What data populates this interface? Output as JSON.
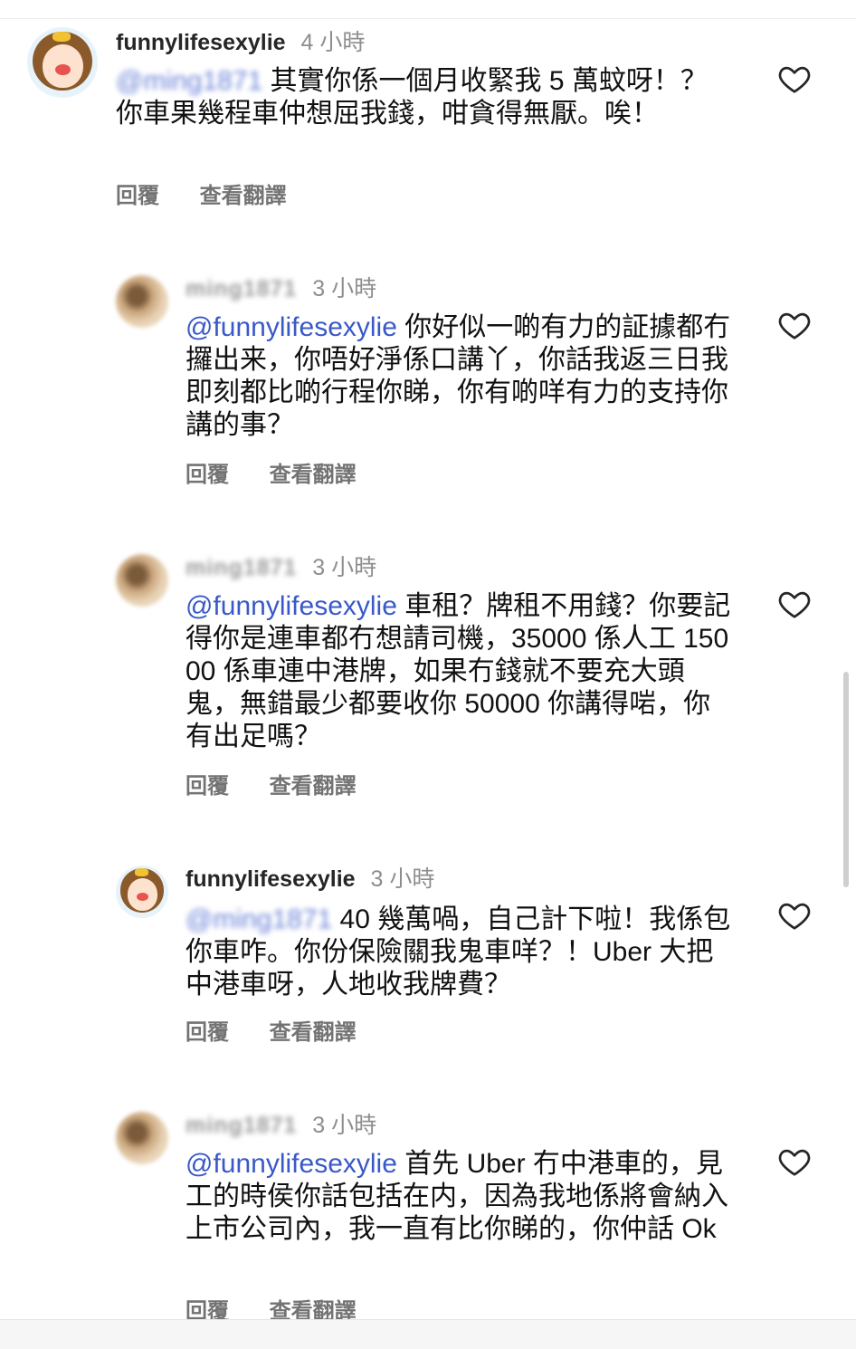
{
  "comments": [
    {
      "username": "funnylifesexylie",
      "username_blurred": false,
      "time": "4 小時",
      "mention": "@ming1871",
      "mention_blurred": true,
      "text": " 其實你係一個月收緊我 5 萬蚊呀！？你車果幾程車仲想屈我錢，咁貪得無厭。唉！",
      "reply_label": "回覆",
      "translate_label": "查看翻譯",
      "avatar_icon": "cartoon-girl-avatar"
    },
    {
      "username": "ming1871",
      "username_blurred": true,
      "time": "3 小時",
      "mention": "@funnylifesexylie",
      "mention_blurred": false,
      "text": " 你好似一啲有力的証據都冇攞出来，你唔好淨係口講丫，你話我返三日我即刻都比啲行程你睇，你有啲咩有力的支持你講的事？",
      "reply_label": "回覆",
      "translate_label": "查看翻譯",
      "avatar_icon": "blurred-photo-avatar"
    },
    {
      "username": "ming1871",
      "username_blurred": true,
      "time": "3 小時",
      "mention": "@funnylifesexylie",
      "mention_blurred": false,
      "text": " 車租？牌租不用錢？你要記得你是連車都冇想請司機，35000 係人工 15000 係車連中港牌，如果冇錢就不要充大頭鬼，無錯最少都要收你 50000 你講得啱，你有出足嗎？",
      "reply_label": "回覆",
      "translate_label": "查看翻譯",
      "avatar_icon": "blurred-photo-avatar"
    },
    {
      "username": "funnylifesexylie",
      "username_blurred": false,
      "time": "3 小時",
      "mention": "@ming1871",
      "mention_blurred": true,
      "text": " 40 幾萬喎，自己計下啦！我係包你車咋。你份保險關我鬼車咩？！Uber 大把中港車呀，人地收我牌費？",
      "reply_label": "回覆",
      "translate_label": "查看翻譯",
      "avatar_icon": "cartoon-girl-avatar"
    },
    {
      "username": "ming1871",
      "username_blurred": true,
      "time": "3 小時",
      "mention": "@funnylifesexylie",
      "mention_blurred": false,
      "text": " 首先 Uber 冇中港車的，見工的時侯你話包括在内，因為我地係將會納入上市公司內，我一直有比你睇的，你仲話 Ok",
      "reply_label": "回覆",
      "translate_label": "查看翻譯",
      "avatar_icon": "blurred-photo-avatar"
    }
  ]
}
